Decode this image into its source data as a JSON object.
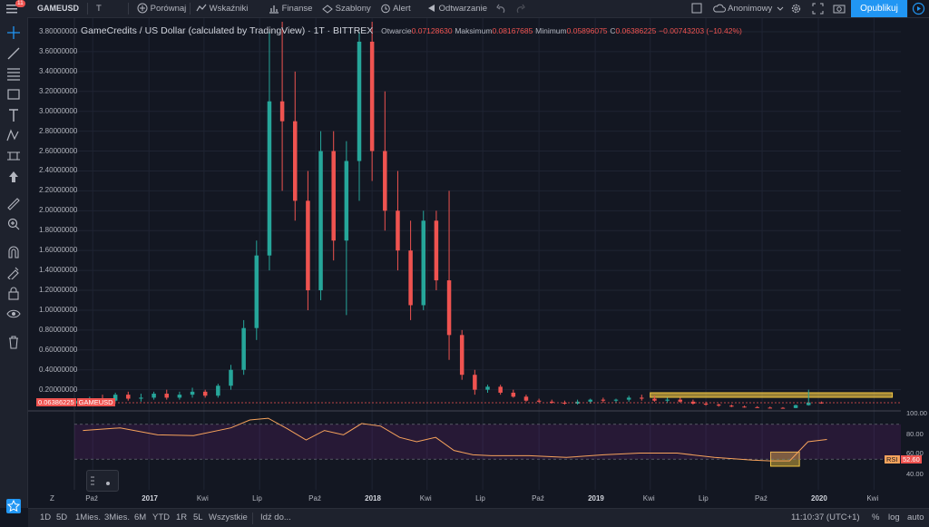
{
  "toolbar": {
    "notification_count": "11",
    "symbol": "GAMEUSD",
    "interval": "T",
    "compare": "Porównaj",
    "indicators": "Wskaźniki",
    "finance": "Finanse",
    "templates": "Szablony",
    "alert": "Alert",
    "replay": "Odtwarzanie",
    "layout_name": "Anonimowy",
    "publish": "Opublikuj"
  },
  "legend": {
    "title": "GameCredits / US Dollar (calculated by TradingView) · 1T · BITTREX",
    "open_label": "Otwarcie",
    "open": "0.07128630",
    "high_label": "Maksimum",
    "high": "0.08167685",
    "low_label": "Minimum",
    "low": "0.05896075",
    "close_label": "C",
    "close": "0.06386225",
    "change": "−0.00743203 (−10.42%)"
  },
  "price_badge": {
    "value": "0.06386225",
    "symbol": "GAMEUSD"
  },
  "price_axis_labels": [
    "3.80000000",
    "3.60000000",
    "3.40000000",
    "3.20000000",
    "3.00000000",
    "2.80000000",
    "2.60000000",
    "2.40000000",
    "2.20000000",
    "2.00000000",
    "1.80000000",
    "1.60000000",
    "1.40000000",
    "1.20000000",
    "1.00000000",
    "0.80000000",
    "0.60000000",
    "0.40000000",
    "0.20000000"
  ],
  "rsi_axis": {
    "top": "100.00",
    "l80": "80.00",
    "l60": "60.00",
    "l40": "40.00",
    "label": "RSI",
    "value": "52.60"
  },
  "time_axis": {
    "labels": [
      "Paź",
      "2017",
      "Kwi",
      "Lip",
      "Paź",
      "2018",
      "Kwi",
      "Lip",
      "Paź",
      "2019",
      "Kwi",
      "Lip",
      "Paź",
      "2020",
      "Kwi"
    ],
    "bold": [
      false,
      true,
      false,
      false,
      false,
      true,
      false,
      false,
      false,
      true,
      false,
      false,
      false,
      true,
      false
    ]
  },
  "bottom": {
    "ranges": [
      "1D",
      "5D",
      "1Mies.",
      "3Mies.",
      "6M",
      "YTD",
      "1R",
      "5L",
      "Wszystkie"
    ],
    "goto": "Idź do...",
    "clock": "11:10:37 (UTC+1)",
    "percent": "%",
    "log": "log",
    "auto": "auto"
  },
  "colors": {
    "up": "#26a69a",
    "down": "#ef5350",
    "accent": "#2196f3",
    "highlight": "#f5c842",
    "rsi_line": "#f7a35c",
    "rsi_band": "#9c27b0"
  },
  "chart_data": {
    "type": "candlestick",
    "title": "GameCredits / US Dollar (calculated by TradingView)",
    "interval": "1T",
    "exchange": "BITTREX",
    "last": {
      "open": 0.0712863,
      "high": 0.08167685,
      "low": 0.05896075,
      "close": 0.06386225,
      "change": -0.00743203,
      "change_pct": -10.42
    },
    "ylim": [
      0,
      3.9
    ],
    "x_range": [
      "2016-09",
      "2020-05"
    ],
    "candles": [
      {
        "date": "2016-09-05",
        "o": 0.065,
        "h": 0.09,
        "l": 0.06,
        "c": 0.08
      },
      {
        "date": "2016-09-26",
        "o": 0.08,
        "h": 0.13,
        "l": 0.07,
        "c": 0.11
      },
      {
        "date": "2016-10-17",
        "o": 0.11,
        "h": 0.15,
        "l": 0.08,
        "c": 0.09
      },
      {
        "date": "2016-11-07",
        "o": 0.09,
        "h": 0.17,
        "l": 0.08,
        "c": 0.15
      },
      {
        "date": "2016-11-28",
        "o": 0.15,
        "h": 0.18,
        "l": 0.09,
        "c": 0.11
      },
      {
        "date": "2016-12-19",
        "o": 0.11,
        "h": 0.16,
        "l": 0.08,
        "c": 0.12
      },
      {
        "date": "2017-01-09",
        "o": 0.12,
        "h": 0.18,
        "l": 0.1,
        "c": 0.16
      },
      {
        "date": "2017-01-30",
        "o": 0.16,
        "h": 0.2,
        "l": 0.1,
        "c": 0.12
      },
      {
        "date": "2017-02-20",
        "o": 0.12,
        "h": 0.18,
        "l": 0.1,
        "c": 0.15
      },
      {
        "date": "2017-03-13",
        "o": 0.15,
        "h": 0.22,
        "l": 0.12,
        "c": 0.18
      },
      {
        "date": "2017-04-03",
        "o": 0.18,
        "h": 0.2,
        "l": 0.12,
        "c": 0.14
      },
      {
        "date": "2017-04-24",
        "o": 0.14,
        "h": 0.26,
        "l": 0.12,
        "c": 0.24
      },
      {
        "date": "2017-05-15",
        "o": 0.24,
        "h": 0.45,
        "l": 0.2,
        "c": 0.4
      },
      {
        "date": "2017-06-05",
        "o": 0.4,
        "h": 0.9,
        "l": 0.35,
        "c": 0.82
      },
      {
        "date": "2017-06-26",
        "o": 0.82,
        "h": 1.7,
        "l": 0.7,
        "c": 1.55
      },
      {
        "date": "2017-07-17",
        "o": 1.55,
        "h": 3.8,
        "l": 1.4,
        "c": 3.1
      },
      {
        "date": "2017-08-07",
        "o": 3.1,
        "h": 3.9,
        "l": 2.2,
        "c": 2.9
      },
      {
        "date": "2017-08-28",
        "o": 2.9,
        "h": 3.4,
        "l": 1.9,
        "c": 2.1
      },
      {
        "date": "2017-09-18",
        "o": 2.1,
        "h": 2.4,
        "l": 1.0,
        "c": 1.2
      },
      {
        "date": "2017-10-09",
        "o": 1.2,
        "h": 2.8,
        "l": 1.1,
        "c": 2.6
      },
      {
        "date": "2017-10-30",
        "o": 2.6,
        "h": 2.8,
        "l": 1.5,
        "c": 1.7
      },
      {
        "date": "2017-11-20",
        "o": 1.7,
        "h": 2.7,
        "l": 0.95,
        "c": 2.5
      },
      {
        "date": "2017-12-11",
        "o": 2.5,
        "h": 3.8,
        "l": 2.1,
        "c": 3.7
      },
      {
        "date": "2018-01-01",
        "o": 3.7,
        "h": 3.9,
        "l": 2.3,
        "c": 2.6
      },
      {
        "date": "2018-01-22",
        "o": 2.6,
        "h": 3.2,
        "l": 1.8,
        "c": 2.0
      },
      {
        "date": "2018-02-12",
        "o": 2.0,
        "h": 2.4,
        "l": 1.4,
        "c": 1.6
      },
      {
        "date": "2018-03-05",
        "o": 1.6,
        "h": 1.9,
        "l": 0.9,
        "c": 1.05
      },
      {
        "date": "2018-03-26",
        "o": 1.05,
        "h": 2.0,
        "l": 1.0,
        "c": 1.9
      },
      {
        "date": "2018-04-16",
        "o": 1.9,
        "h": 2.0,
        "l": 1.2,
        "c": 1.3
      },
      {
        "date": "2018-05-07",
        "o": 1.3,
        "h": 2.2,
        "l": 0.5,
        "c": 0.75
      },
      {
        "date": "2018-05-28",
        "o": 0.75,
        "h": 0.8,
        "l": 0.3,
        "c": 0.35
      },
      {
        "date": "2018-06-18",
        "o": 0.35,
        "h": 0.4,
        "l": 0.15,
        "c": 0.2
      },
      {
        "date": "2018-07-09",
        "o": 0.2,
        "h": 0.25,
        "l": 0.17,
        "c": 0.23
      },
      {
        "date": "2018-07-30",
        "o": 0.23,
        "h": 0.25,
        "l": 0.15,
        "c": 0.17
      },
      {
        "date": "2018-08-20",
        "o": 0.17,
        "h": 0.2,
        "l": 0.12,
        "c": 0.13
      },
      {
        "date": "2018-09-10",
        "o": 0.13,
        "h": 0.15,
        "l": 0.08,
        "c": 0.09
      },
      {
        "date": "2018-10-01",
        "o": 0.09,
        "h": 0.11,
        "l": 0.07,
        "c": 0.08
      },
      {
        "date": "2018-10-22",
        "o": 0.08,
        "h": 0.1,
        "l": 0.06,
        "c": 0.07
      },
      {
        "date": "2018-11-12",
        "o": 0.07,
        "h": 0.09,
        "l": 0.05,
        "c": 0.06
      },
      {
        "date": "2018-12-03",
        "o": 0.06,
        "h": 0.1,
        "l": 0.05,
        "c": 0.08
      },
      {
        "date": "2018-12-24",
        "o": 0.08,
        "h": 0.11,
        "l": 0.06,
        "c": 0.1
      },
      {
        "date": "2019-01-14",
        "o": 0.1,
        "h": 0.12,
        "l": 0.07,
        "c": 0.09
      },
      {
        "date": "2019-02-04",
        "o": 0.09,
        "h": 0.11,
        "l": 0.07,
        "c": 0.1
      },
      {
        "date": "2019-02-25",
        "o": 0.1,
        "h": 0.14,
        "l": 0.08,
        "c": 0.12
      },
      {
        "date": "2019-03-18",
        "o": 0.12,
        "h": 0.15,
        "l": 0.09,
        "c": 0.11
      },
      {
        "date": "2019-04-08",
        "o": 0.11,
        "h": 0.14,
        "l": 0.08,
        "c": 0.09
      },
      {
        "date": "2019-04-29",
        "o": 0.09,
        "h": 0.12,
        "l": 0.07,
        "c": 0.1
      },
      {
        "date": "2019-05-20",
        "o": 0.1,
        "h": 0.12,
        "l": 0.07,
        "c": 0.08
      },
      {
        "date": "2019-06-10",
        "o": 0.08,
        "h": 0.1,
        "l": 0.05,
        "c": 0.06
      },
      {
        "date": "2019-07-01",
        "o": 0.06,
        "h": 0.08,
        "l": 0.04,
        "c": 0.05
      },
      {
        "date": "2019-07-22",
        "o": 0.05,
        "h": 0.06,
        "l": 0.03,
        "c": 0.04
      },
      {
        "date": "2019-08-12",
        "o": 0.04,
        "h": 0.05,
        "l": 0.025,
        "c": 0.03
      },
      {
        "date": "2019-09-02",
        "o": 0.03,
        "h": 0.04,
        "l": 0.02,
        "c": 0.025
      },
      {
        "date": "2019-09-23",
        "o": 0.025,
        "h": 0.035,
        "l": 0.018,
        "c": 0.02
      },
      {
        "date": "2019-10-14",
        "o": 0.02,
        "h": 0.03,
        "l": 0.015,
        "c": 0.018
      },
      {
        "date": "2019-11-04",
        "o": 0.018,
        "h": 0.025,
        "l": 0.014,
        "c": 0.016
      },
      {
        "date": "2019-11-25",
        "o": 0.016,
        "h": 0.05,
        "l": 0.014,
        "c": 0.045
      },
      {
        "date": "2019-12-16",
        "o": 0.045,
        "h": 0.2,
        "l": 0.04,
        "c": 0.0713
      },
      {
        "date": "2020-01-06",
        "o": 0.0713,
        "h": 0.0817,
        "l": 0.059,
        "c": 0.0639
      }
    ],
    "rsi": {
      "name": "RSI",
      "value": 52.6,
      "levels": [
        30,
        70
      ],
      "ylim": [
        0,
        100
      ],
      "dates": [
        "2016-09",
        "2016-11",
        "2017-01",
        "2017-03",
        "2017-05",
        "2017-06",
        "2017-07",
        "2017-08",
        "2017-09",
        "2017-10",
        "2017-11",
        "2017-12",
        "2018-01",
        "2018-02",
        "2018-03",
        "2018-04",
        "2018-05",
        "2018-06",
        "2018-07",
        "2018-09",
        "2018-11",
        "2019-01",
        "2019-03",
        "2019-05",
        "2019-07",
        "2019-09",
        "2019-10",
        "2019-11",
        "2019-12",
        "2020-01"
      ],
      "values": [
        63,
        66,
        58,
        57,
        66,
        75,
        77,
        65,
        52,
        63,
        58,
        71,
        68,
        55,
        50,
        55,
        40,
        35,
        34,
        34,
        32,
        35,
        37,
        37,
        32,
        29,
        28,
        28,
        50,
        52.6
      ]
    },
    "annotations": [
      {
        "type": "rectangle",
        "from": "2019-04",
        "to": "2020-05",
        "y_low": 0.06,
        "y_high": 0.12,
        "color": "#f5c842"
      },
      {
        "type": "rectangle",
        "pane": "rsi",
        "from": "2019-10",
        "to": "2019-12",
        "y_low": 24,
        "y_high": 34,
        "color": "#f5c842"
      }
    ]
  }
}
